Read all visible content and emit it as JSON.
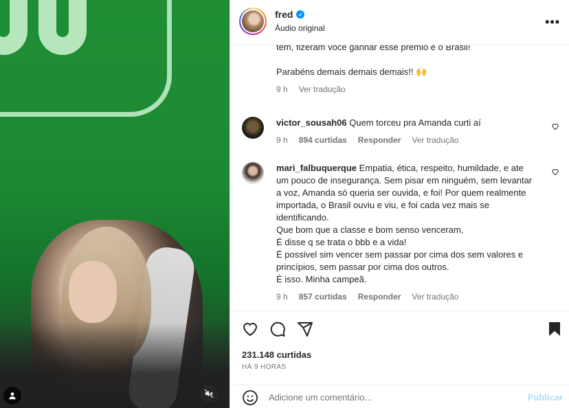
{
  "header": {
    "username": "fred",
    "subtitle": "Áudio original"
  },
  "top_comment": {
    "line_partial": "têm, fizeram você ganhar esse prêmio e o Brasil!",
    "line2": "Parabéns demais demais demais!! 🙌",
    "time": "9 h",
    "translate": "Ver tradução"
  },
  "comments": [
    {
      "user": "victor_sousah06",
      "text": "Quem torceu pra Amanda curti aí",
      "time": "9 h",
      "likes": "894 curtidas",
      "reply": "Responder",
      "translate": "Ver tradução"
    },
    {
      "user": "mari_falbuquerque",
      "text": "Empatia, ética, respeito, humildade, e ate um pouco de insegurança. Sem pisar em ninguém, sem levantar a voz, Amanda só queria ser ouvida, e foi! Por quem realmente importada, o Brasil ouviu e viu, e foi cada vez mais se identificando.\nQue bom que a classe e bom senso venceram,\nÉ disse q se trata o bbb e a vida!\nÉ possivel sim vencer sem passar por cima dos sem valores e princípios, sem passar por cima dos outros.\nÉ isso. Minha campeã.",
      "time": "9 h",
      "likes": "857 curtidas",
      "reply": "Responder",
      "translate": "Ver tradução"
    }
  ],
  "post": {
    "likes": "231.148 curtidas",
    "time_ago": "HÁ 9 HORAS"
  },
  "add_comment": {
    "placeholder": "Adicione um comentário...",
    "post_label": "Publicar"
  },
  "colors": {
    "verified": "#0095f6",
    "publish_disabled": "#b3dbff",
    "muted_text": "#737373"
  }
}
